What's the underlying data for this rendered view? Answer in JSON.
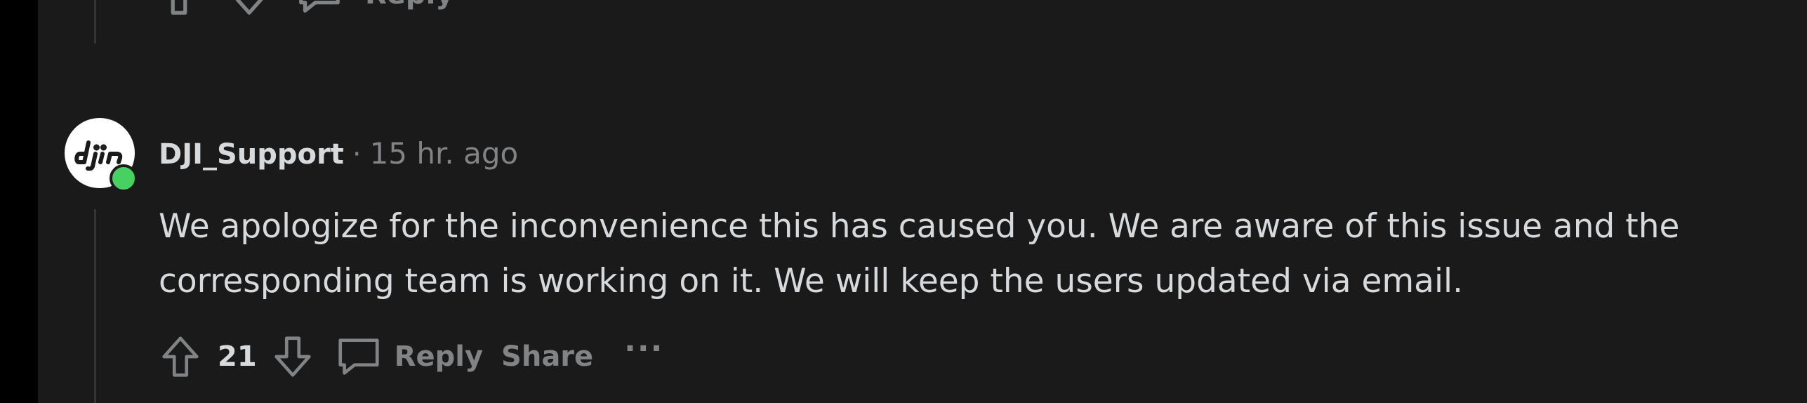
{
  "comment": {
    "author": "DJI_Support",
    "separator": "·",
    "timestamp": "15 hr. ago",
    "body": "We apologize for the inconvenience this has caused you. We are aware of this issue and the corresponding team is working on it. We will keep the users updated via email.",
    "avatar_icon": "dji-logo-icon",
    "online_status_color": "#46d160",
    "actions": {
      "vote_count": "21",
      "reply_label": "Reply",
      "share_label": "Share",
      "more_label": "···"
    }
  },
  "previous_comment_actions": {
    "reply_label": "Reply"
  },
  "colors": {
    "background": "#1a1a1b",
    "text_primary": "#d7dadc",
    "text_muted": "#818384",
    "thread_line": "#343536"
  }
}
